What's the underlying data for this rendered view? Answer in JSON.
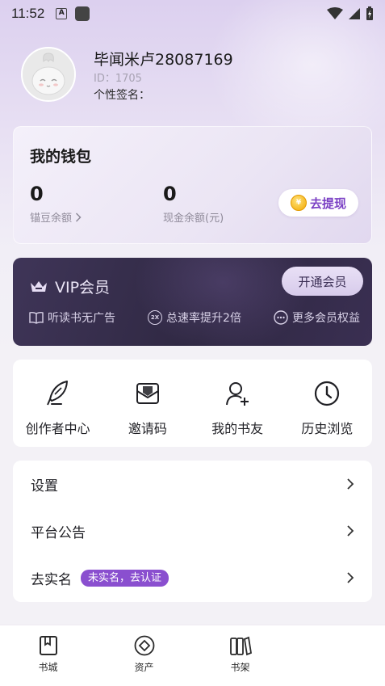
{
  "status_bar": {
    "time": "11:52",
    "notif_icon_letter": "A",
    "icons": [
      "a-notification-icon",
      "app-notification-icon",
      "wifi-icon",
      "signal-icon",
      "battery-charging-icon"
    ]
  },
  "profile": {
    "username": "毕闻米卢28087169",
    "user_id": "ID：1705",
    "signature": "个性签名："
  },
  "wallet": {
    "title": "我的钱包",
    "beans_value": "0",
    "beans_label": "锚豆余额",
    "cash_value": "0",
    "cash_label": "现金余额(元)",
    "withdraw_label": "去提现",
    "coin_glyph": "¥"
  },
  "vip": {
    "title": "VIP会员",
    "button_label": "开通会员",
    "perks": [
      {
        "label": "听读书无广告",
        "icon": "book-icon"
      },
      {
        "label": "总速率提升2倍",
        "icon": "speed-2x-icon",
        "glyph": "2X"
      },
      {
        "label": "更多会员权益",
        "icon": "more-dots-icon"
      }
    ]
  },
  "quick_actions": [
    {
      "label": "创作者中心",
      "icon": "quill-icon"
    },
    {
      "label": "邀请码",
      "icon": "envelope-icon"
    },
    {
      "label": "我的书友",
      "icon": "add-friend-icon"
    },
    {
      "label": "历史浏览",
      "icon": "clock-icon"
    }
  ],
  "menu": {
    "settings": "设置",
    "announcements": "平台公告",
    "realname": "去实名",
    "realname_badge": "未实名，去认证"
  },
  "tabbar": [
    {
      "label": "书城",
      "icon": "bookmark-book-icon"
    },
    {
      "label": "资产",
      "icon": "diamond-coin-icon"
    },
    {
      "label": "书架",
      "icon": "bookshelf-icon"
    }
  ],
  "colors": {
    "accent": "#7a3fc4",
    "badge": "#8a4fcf",
    "vip_bg": "#2f2842"
  }
}
